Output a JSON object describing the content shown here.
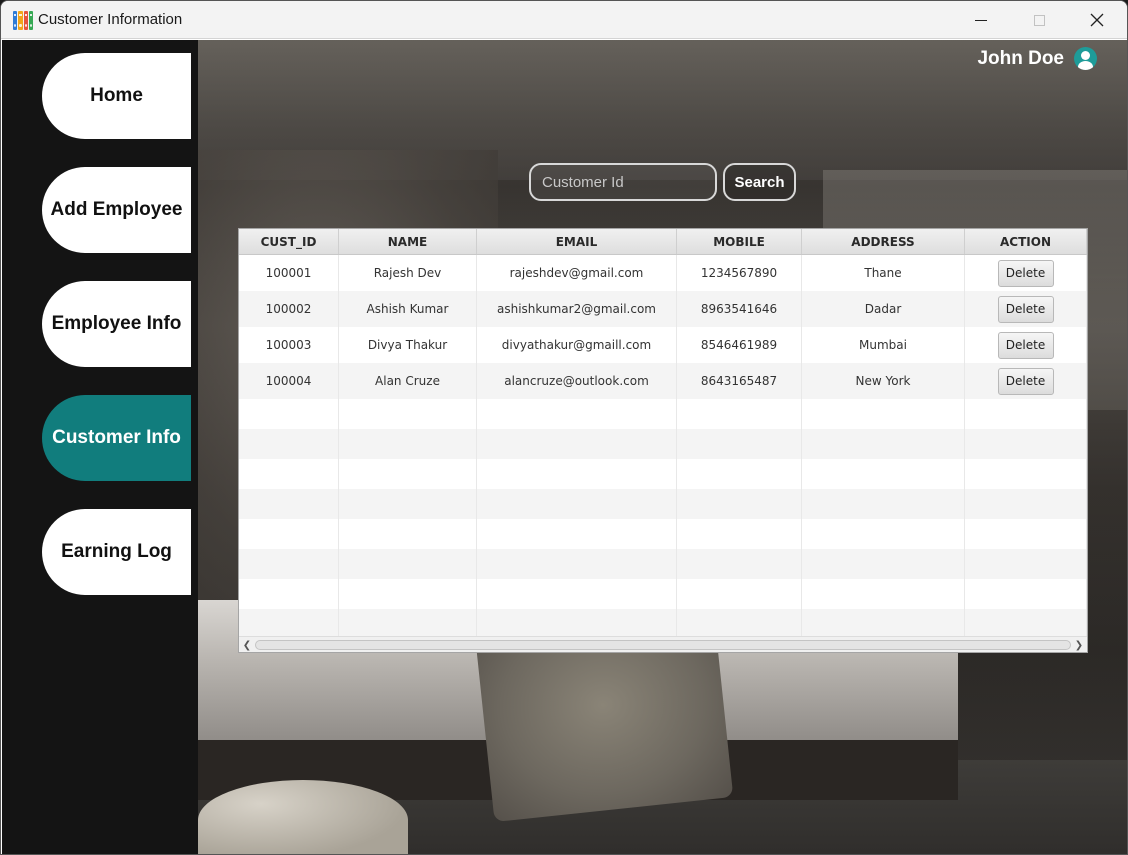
{
  "window": {
    "title": "Customer Information"
  },
  "sidebar": {
    "items": [
      {
        "label": "Home",
        "active": false
      },
      {
        "label": "Add Employee",
        "active": false
      },
      {
        "label": "Employee Info",
        "active": false
      },
      {
        "label": "Customer Info",
        "active": true
      },
      {
        "label": "Earning Log",
        "active": false
      }
    ]
  },
  "header": {
    "user_name": "John Doe"
  },
  "search": {
    "placeholder": "Customer Id",
    "value": "",
    "button_label": "Search"
  },
  "table": {
    "columns": [
      "CUST_ID",
      "NAME",
      "EMAIL",
      "MOBILE",
      "ADDRESS",
      "ACTION"
    ],
    "rows": [
      {
        "cust_id": "100001",
        "name": "Rajesh Dev",
        "email": "rajeshdev@gmail.com",
        "mobile": "1234567890",
        "address": "Thane",
        "action": "Delete"
      },
      {
        "cust_id": "100002",
        "name": "Ashish Kumar",
        "email": "ashishkumar2@gmail.com",
        "mobile": "8963541646",
        "address": "Dadar",
        "action": "Delete"
      },
      {
        "cust_id": "100003",
        "name": "Divya Thakur",
        "email": "divyathakur@gmaill.com",
        "mobile": "8546461989",
        "address": "Mumbai",
        "action": "Delete"
      },
      {
        "cust_id": "100004",
        "name": "Alan Cruze",
        "email": "alancruze@outlook.com",
        "mobile": "8643165487",
        "address": "New York",
        "action": "Delete"
      }
    ]
  },
  "colors": {
    "accent": "#117d7d",
    "sidebar_bg": "#141414",
    "avatar": "#1e9c99"
  },
  "icons": {
    "app": "colorful-binders-icon",
    "user": "user-avatar-icon"
  }
}
